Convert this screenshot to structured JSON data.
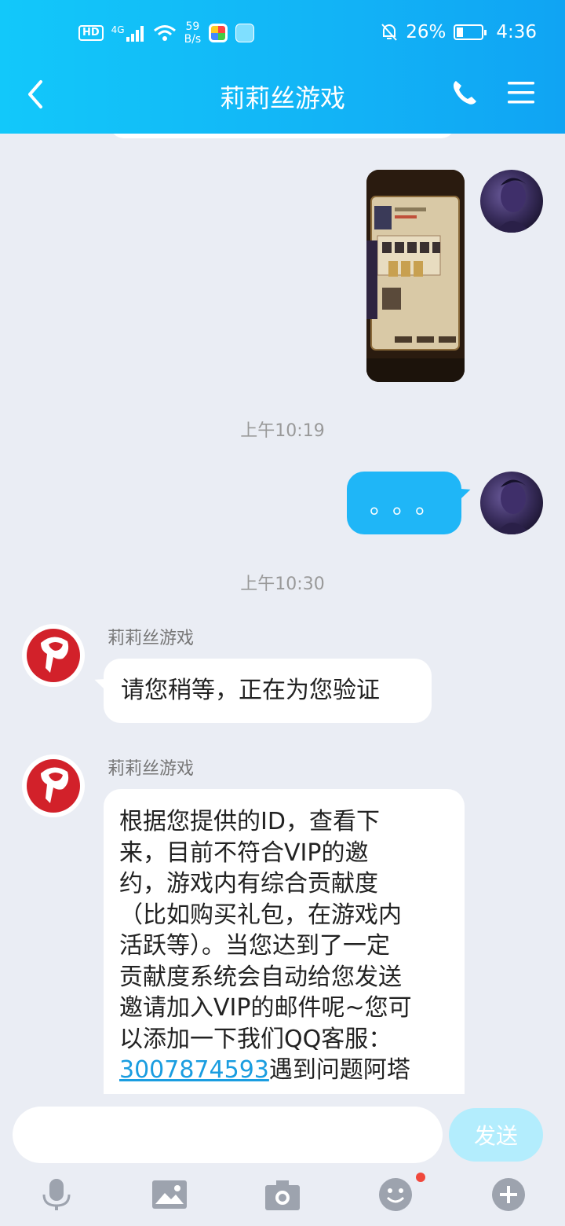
{
  "status_bar": {
    "hd": "HD",
    "network": "4G",
    "speed_value": "59",
    "speed_unit": "B/s",
    "battery": "26%",
    "time": "4:36"
  },
  "header": {
    "title": "莉莉丝游戏"
  },
  "chat": {
    "timestamp_1": "上午10:19",
    "outgoing_text": "。。。",
    "timestamp_2": "上午10:30",
    "messages": [
      {
        "sender": "莉莉丝游戏",
        "text": "请您稍等，正在为您验证"
      },
      {
        "sender": "莉莉丝游戏",
        "lines": [
          "根据您提供的ID，查看下",
          "来，目前不符合VIP的邀",
          "约，游戏内有综合贡献度",
          "（比如购买礼包，在游戏内",
          "活跃等）。当您达到了一定",
          "贡献度系统会自动给您发送",
          "邀请加入VIP的邮件呢~您可",
          "以添加一下我们QQ客服："
        ],
        "qq_number": "3007874593",
        "after_link": "遇到问题阿塔"
      }
    ]
  },
  "input": {
    "value": "",
    "send_label": "发送"
  },
  "colors": {
    "header": "#12B3F6",
    "outgoing_bubble": "#1FB6F7",
    "link": "#1A9DE0",
    "send_disabled": "#B3EDFD"
  }
}
